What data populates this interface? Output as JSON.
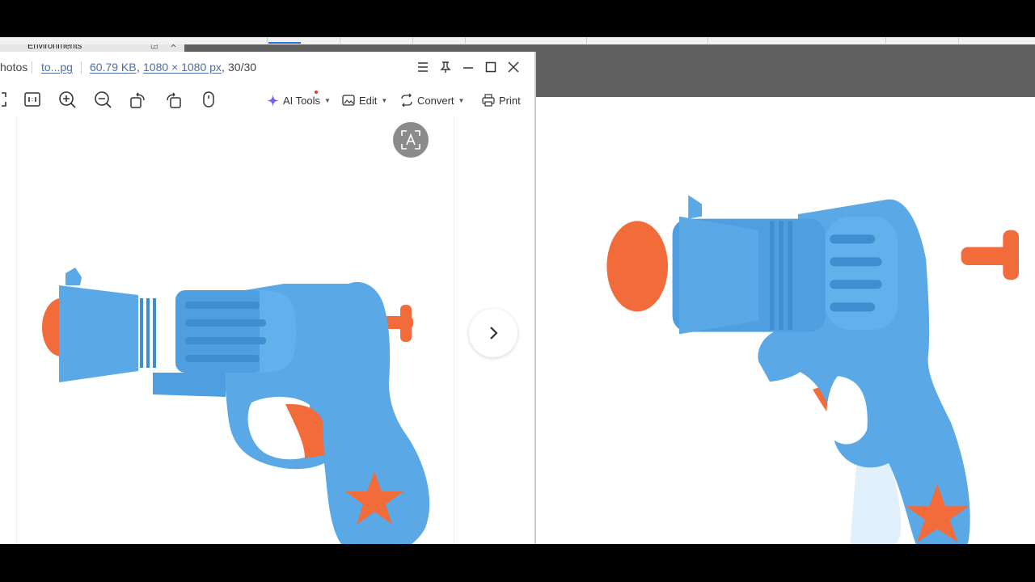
{
  "background_app": {
    "env_tab": "Environments",
    "env_tab_controls": "◲ ✕"
  },
  "viewer": {
    "app_fragment": "hotos",
    "file_name": "to...pg",
    "file_size": "60.79 KB",
    "dimensions": "1080 × 1080 px",
    "counter": "30/30"
  },
  "toolbar": {
    "ai_tools": "AI Tools",
    "edit": "Edit",
    "convert": "Convert",
    "print": "Print"
  },
  "colors": {
    "gun_blue": "#5aa9e6",
    "gun_blue_dark": "#3d8fd0",
    "gun_orange": "#f26b3a",
    "ai_sparkle": "#7b5cf0"
  },
  "icons": [
    "fullscreen-icon",
    "original-size-icon",
    "zoom-in-icon",
    "zoom-out-icon",
    "rotate-left-icon",
    "rotate-right-icon",
    "mouse-icon",
    "ai-sparkle-icon",
    "edit-image-icon",
    "convert-icon",
    "print-icon",
    "menu-icon",
    "pin-icon",
    "minimize-icon",
    "maximize-icon",
    "close-icon",
    "text-recognition-icon",
    "chevron-right-icon"
  ]
}
